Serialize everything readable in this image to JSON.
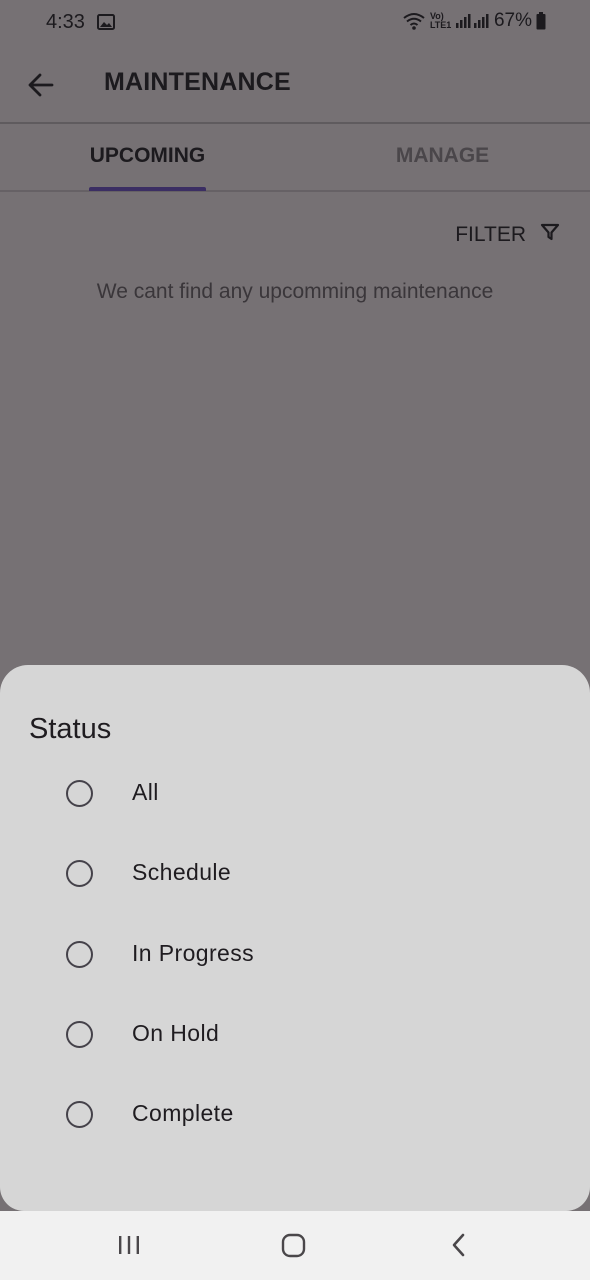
{
  "status_bar": {
    "time": "4:33",
    "network_label": "Vo) LTE1",
    "battery": "67%",
    "icons": [
      "image-icon",
      "wifi-icon",
      "signal-icon",
      "battery-icon"
    ]
  },
  "app_bar": {
    "title": "MAINTENANCE",
    "back_icon": "arrow-left-icon"
  },
  "tabs": [
    {
      "label": "UPCOMING",
      "selected": true
    },
    {
      "label": "MANAGE",
      "selected": false
    }
  ],
  "filter": {
    "label": "FILTER",
    "icon": "funnel-icon"
  },
  "empty_message": "We cant find any upcomming maintenance",
  "status_sheet": {
    "title": "Status",
    "options": [
      {
        "label": "All",
        "selected": false
      },
      {
        "label": "Schedule",
        "selected": false
      },
      {
        "label": "In Progress",
        "selected": false
      },
      {
        "label": "On Hold",
        "selected": false
      },
      {
        "label": "Complete",
        "selected": false
      }
    ]
  },
  "nav_bar": {
    "buttons": [
      "recents-icon",
      "home-icon",
      "back-icon"
    ]
  },
  "colors": {
    "scrim_background": "#767174",
    "sheet_background": "#d6d6d6",
    "tab_indicator": "#3b2e63",
    "nav_background": "#f1f1f1"
  }
}
